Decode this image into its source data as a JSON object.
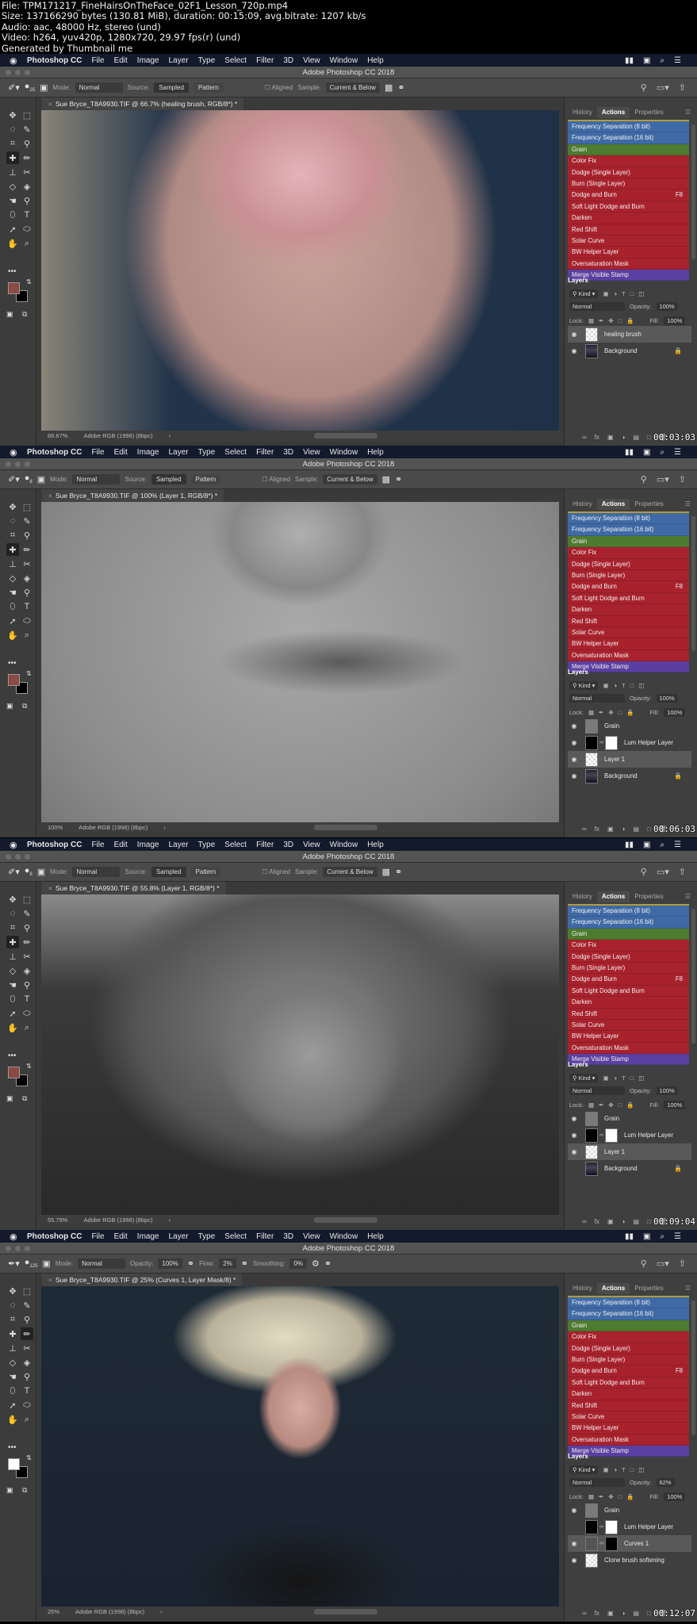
{
  "info": {
    "line1": "File: TPM171217_FineHairsOnTheFace_02F1_Lesson_720p.mp4",
    "line2": "Size: 137166290 bytes (130.81 MiB), duration: 00:15:09, avg.bitrate: 1207 kb/s",
    "line3": "Audio: aac, 48000 Hz, stereo (und)",
    "line4": "Video: h264, yuv420p, 1280x720, 29.97 fps(r) (und)",
    "line5": "Generated by Thumbnail me"
  },
  "menubar": {
    "apple": "",
    "app": "Photoshop CC",
    "items": [
      "File",
      "Edit",
      "Image",
      "Layer",
      "Type",
      "Select",
      "Filter",
      "3D",
      "View",
      "Window",
      "Help"
    ],
    "right_icons": [
      "▮▮",
      "▣",
      "⌕",
      "☰"
    ]
  },
  "window_title": "Adobe Photoshop CC 2018",
  "colors": {
    "menubar_bg": "#121a2c",
    "action_blue": "#3f6aa6",
    "action_green": "#4d7b2f",
    "action_red": "#a8222d",
    "action_purple": "#5b3fa0",
    "foreground_swatch_1": "#8b4a42",
    "foreground_swatch_4": "#ffffff"
  },
  "actions": [
    {
      "label": "Frequency Separation (8 bit)",
      "color": "blue",
      "key": ""
    },
    {
      "label": "Frequency Separation (16 bit)",
      "color": "blue",
      "key": ""
    },
    {
      "label": "Grain",
      "color": "green",
      "key": ""
    },
    {
      "label": "Color Fix",
      "color": "red",
      "key": ""
    },
    {
      "label": "Dodge (Single Layer)",
      "color": "red",
      "key": ""
    },
    {
      "label": "Burn (Single Layer)",
      "color": "red",
      "key": ""
    },
    {
      "label": "Dodge and Burn",
      "color": "red",
      "key": "F8"
    },
    {
      "label": "Soft Light Dodge and Burn",
      "color": "red",
      "key": ""
    },
    {
      "label": "Darken",
      "color": "red",
      "key": ""
    },
    {
      "label": "Red Shift",
      "color": "red",
      "key": ""
    },
    {
      "label": "Solar Curve",
      "color": "red",
      "key": ""
    },
    {
      "label": "BW Helper Layer",
      "color": "red",
      "key": ""
    },
    {
      "label": "Oversaturation Mask",
      "color": "red",
      "key": ""
    },
    {
      "label": "Merge Visible Stamp",
      "color": "purple",
      "key": ""
    }
  ],
  "panel_tabs": [
    "History",
    "Actions",
    "Properties"
  ],
  "layers_panel": {
    "title": "Layers",
    "kind": "Kind",
    "blend_mode": "Normal",
    "opacity_label": "Opacity:",
    "lock_label": "Lock:",
    "fill_label": "Fill:",
    "fill": "100%"
  },
  "frames": [
    {
      "healing": true,
      "brush_size": "25",
      "doc_tab": "Sue Bryce_T8A9930.TIF @ 66.7% (healing brush, RGB/8*) *",
      "zoom": "66.67%",
      "profile": "Adobe RGB (1998) (8bpc)",
      "timecode": "00:03:03",
      "opacity": "100%",
      "fg_color": "#8b4a42",
      "layers": [
        {
          "name": "healing brush",
          "thumb": "trans",
          "selected": true,
          "visible": true
        },
        {
          "name": "Background",
          "thumb": "photo",
          "locked": true,
          "visible": true
        }
      ]
    },
    {
      "healing": true,
      "brush_size": "8",
      "doc_tab": "Sue Bryce_T8A9930.TIF @ 100% (Layer 1, RGB/8*) *",
      "zoom": "100%",
      "profile": "Adobe RGB (1998) (8bpc)",
      "timecode": "00:06:03",
      "opacity": "100%",
      "fg_color": "#8b4a42",
      "layers": [
        {
          "name": "Grain",
          "thumb": "gray",
          "visible": true
        },
        {
          "name": "Lum Helper Layer",
          "thumb": "black",
          "mask": "white",
          "visible": true
        },
        {
          "name": "Layer 1",
          "thumb": "trans",
          "selected": true,
          "visible": true
        },
        {
          "name": "Background",
          "thumb": "photo",
          "locked": true,
          "visible": true
        }
      ]
    },
    {
      "healing": true,
      "brush_size": "8",
      "doc_tab": "Sue Bryce_T8A9930.TIF @ 55.8% (Layer 1, RGB/8*) *",
      "zoom": "55.79%",
      "profile": "Adobe RGB (1998) (8bpc)",
      "timecode": "00:09:04",
      "opacity": "100%",
      "fg_color": "#8b4a42",
      "layers": [
        {
          "name": "Grain",
          "thumb": "gray",
          "visible": true
        },
        {
          "name": "Lum Helper Layer",
          "thumb": "black",
          "mask": "white",
          "visible": true
        },
        {
          "name": "Layer 1",
          "thumb": "trans",
          "selected": true,
          "visible": true
        },
        {
          "name": "Background",
          "thumb": "photo",
          "locked": true,
          "visible": false
        }
      ]
    },
    {
      "healing": false,
      "brush_size": "125",
      "doc_tab": "Sue Bryce_T8A9930.TIF @ 25% (Curves 1, Layer Mask/8) *",
      "zoom": "25%",
      "profile": "Adobe RGB (1998) (8bpc)",
      "timecode": "00:12:07",
      "opacity": "62%",
      "fg_color": "#ffffff",
      "layers": [
        {
          "name": "Grain",
          "thumb": "gray",
          "visible": true
        },
        {
          "name": "Lum Helper Layer",
          "thumb": "black",
          "mask": "white",
          "visible": false
        },
        {
          "name": "Curves 1",
          "thumb": "adj",
          "mask": "black",
          "selected": true,
          "visible": true
        },
        {
          "name": "Clone brush softening",
          "thumb": "trans",
          "visible": true
        }
      ]
    }
  ],
  "healing_options": {
    "mode_label": "Mode:",
    "mode": "Normal",
    "source_label": "Source:",
    "sampled": "Sampled",
    "pattern": "Pattern",
    "aligned": "Aligned",
    "sample_label": "Sample:",
    "sample": "Current & Below"
  },
  "brush_options": {
    "mode_label": "Mode:",
    "mode": "Normal",
    "opacity_label": "Opacity:",
    "opacity": "100%",
    "flow_label": "Flow:",
    "flow": "2%",
    "smoothing_label": "Smoothing:",
    "smoothing": "0%"
  },
  "tools": [
    "✥",
    "⬚",
    "◌",
    "✎",
    "⌗",
    "⚲",
    "✚",
    "✏",
    "⊥",
    "✂",
    "◇",
    "◈",
    "☚",
    "⚲",
    "⬯",
    "T",
    "➚",
    "⬭",
    "✋",
    "⌕"
  ]
}
